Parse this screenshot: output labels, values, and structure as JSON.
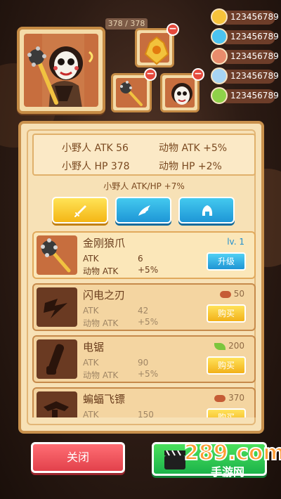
{
  "hp_display": "378 / 378",
  "resources": [
    {
      "icon": "coin-icon",
      "value": "123456789"
    },
    {
      "icon": "gem-icon",
      "value": "123456789"
    },
    {
      "icon": "bone-icon",
      "value": "123456789"
    },
    {
      "icon": "blade-icon",
      "value": "123456789"
    },
    {
      "icon": "leaf-icon",
      "value": "123456789"
    }
  ],
  "stats": {
    "atk_label": "小野人 ATK 56",
    "animal_atk_label": "动物 ATK +5%",
    "hp_label": "小野人 HP 378",
    "animal_hp_label": "动物 HP +2%",
    "combo_label": "小野人 ATK/HP +7%"
  },
  "tabs": [
    {
      "name": "weapon",
      "icon": "sword-icon"
    },
    {
      "name": "wing",
      "icon": "wing-icon"
    },
    {
      "name": "armor",
      "icon": "helmet-icon"
    }
  ],
  "items": [
    {
      "name": "金刚狼爪",
      "k1": "ATK",
      "v1": "6",
      "k2": "动物 ATK",
      "v2": "+5%",
      "level": "lv. 1",
      "button": "升级"
    },
    {
      "name": "闪电之刃",
      "k1": "ATK",
      "v1": "42",
      "k2": "动物 ATK",
      "v2": "+5%",
      "cost": "50",
      "cost_icon": "bone-icon",
      "button": "购买"
    },
    {
      "name": "电锯",
      "k1": "ATK",
      "v1": "90",
      "k2": "动物 ATK",
      "v2": "+5%",
      "cost": "200",
      "cost_icon": "leaf-icon",
      "button": "购买"
    },
    {
      "name": "蝙蝠飞镖",
      "k1": "ATK",
      "v1": "150",
      "k2": "",
      "v2": "",
      "cost": "370",
      "cost_icon": "bone-icon",
      "button": "购买"
    }
  ],
  "bottom": {
    "close_label": "关闭"
  },
  "watermark": {
    "main": "289.com",
    "sub": "手游网"
  },
  "colors": {
    "panel": "#f7e1b6",
    "accent_blue": "#1f94d4",
    "accent_yellow": "#f2b118",
    "close_red": "#e2414b",
    "go_green": "#1bb34a"
  }
}
